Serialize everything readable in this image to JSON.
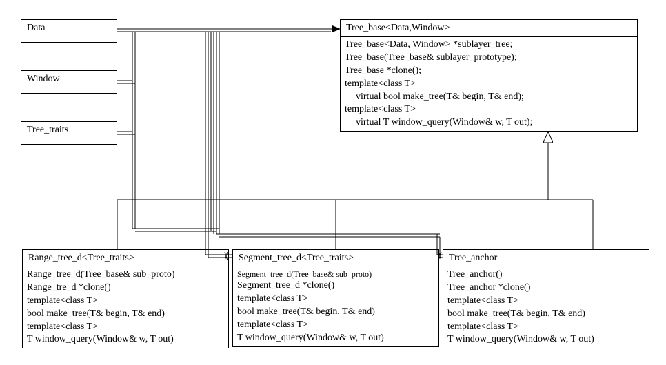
{
  "type": "uml-class-diagram",
  "classes": {
    "data": {
      "name": "Data"
    },
    "window": {
      "name": "Window"
    },
    "tree_traits": {
      "name": "Tree_traits"
    },
    "tree_base": {
      "name": "Tree_base<Data,Window>",
      "members": [
        "Tree_base<Data, Window> *sublayer_tree;",
        "Tree_base(Tree_base& sublayer_prototype);",
        "Tree_base *clone();",
        "template<class T>",
        "    virtual bool make_tree(T& begin, T& end);",
        "template<class T>",
        "    virtual T window_query(Window& w, T out);"
      ]
    },
    "range_tree": {
      "name": "Range_tree_d<Tree_traits>",
      "members": [
        "Range_tree_d(Tree_base& sub_proto)",
        "Range_tre_d *clone()",
        "template<class T>",
        "  bool make_tree(T& begin, T& end)",
        "template<class T>",
        "  T window_query(Window& w, T out)"
      ]
    },
    "segment_tree": {
      "name": "Segment_tree_d<Tree_traits>",
      "members": [
        "Segment_tree_d(Tree_base& sub_proto)",
        "Segment_tree_d *clone()",
        "template<class T>",
        "  bool make_tree(T& begin, T& end)",
        "template<class T>",
        "  T window_query(Window& w, T out)"
      ]
    },
    "tree_anchor": {
      "name": "Tree_anchor",
      "members": [
        "Tree_anchor()",
        "Tree_anchor *clone()",
        "template<class T>",
        "  bool make_tree(T& begin, T& end)",
        "template<class T>",
        "  T window_query(Window& w, T out)"
      ]
    }
  },
  "relationships": [
    {
      "from": "Data",
      "to": "Tree_base",
      "type": "association-with-arrow"
    },
    {
      "from": "Window",
      "to": "Tree_base",
      "type": "association"
    },
    {
      "from": "Tree_traits",
      "to": "Tree_base",
      "type": "association"
    },
    {
      "from": "Range_tree_d",
      "to": "Tree_base",
      "type": "inheritance"
    },
    {
      "from": "Segment_tree_d",
      "to": "Tree_base",
      "type": "inheritance"
    },
    {
      "from": "Tree_anchor",
      "to": "Tree_base",
      "type": "inheritance"
    },
    {
      "from": "left-params",
      "to": "Range_tree_d",
      "type": "association-bundle"
    },
    {
      "from": "left-params",
      "to": "Segment_tree_d",
      "type": "association-bundle"
    },
    {
      "from": "left-params",
      "to": "Tree_anchor",
      "type": "association-bundle"
    }
  ]
}
